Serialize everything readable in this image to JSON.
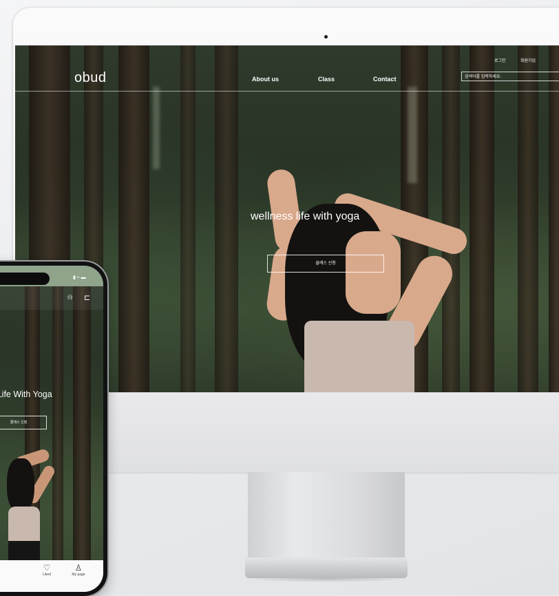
{
  "desktop_site": {
    "logo": "obud",
    "nav": [
      "About us",
      "Class",
      "Contact"
    ],
    "util_links": [
      "로그인",
      "회원가입"
    ],
    "search_placeholder": "검색어를 입력하세요.",
    "hero_text": "wellness life with yoga",
    "cta_label": "클래스 신청"
  },
  "mobile_site": {
    "hero_text": "s Life With Yoga",
    "cta_label": "클래스 신청",
    "header_icons": [
      "bell-icon",
      "cart-icon"
    ],
    "tabs": [
      {
        "icon": "heart-icon",
        "label": "Liked"
      },
      {
        "icon": "person-icon",
        "label": "My page"
      }
    ]
  },
  "colors": {
    "mobile_status_bar": "#8fa48b",
    "forest_dark": "#273224",
    "device_silver": "#e9e9eb"
  }
}
